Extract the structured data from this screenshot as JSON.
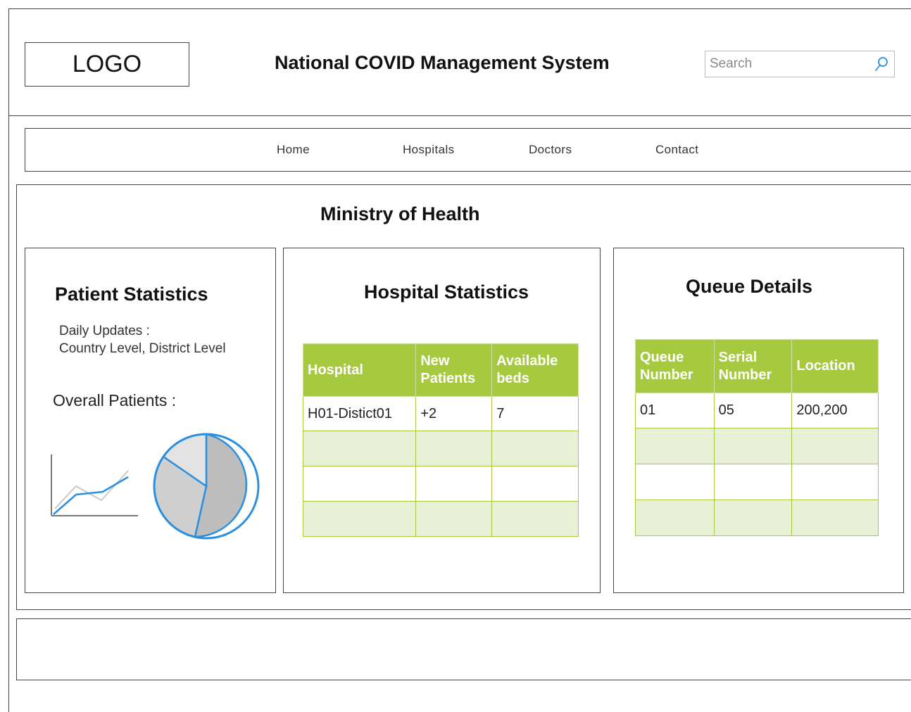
{
  "header": {
    "logo_text": "LOGO",
    "title": "National COVID Management System",
    "search_placeholder": "Search",
    "search_icon": "search-icon"
  },
  "nav": {
    "items": [
      {
        "label": "Home"
      },
      {
        "label": "Hospitals"
      },
      {
        "label": "Doctors"
      },
      {
        "label": "Contact"
      }
    ]
  },
  "main": {
    "title": "Ministry of Health",
    "patient_stats": {
      "title": "Patient Statistics",
      "daily_updates": "Daily Updates :",
      "levels": "Country Level, District Level",
      "overall_label": "Overall Patients :"
    },
    "hospital_stats": {
      "title": "Hospital Statistics",
      "columns": [
        "Hospital",
        "New Patients",
        "Available beds"
      ],
      "rows": [
        [
          "H01-Distict01",
          "+2",
          "7"
        ],
        [
          "",
          "",
          ""
        ],
        [
          "",
          "",
          ""
        ],
        [
          "",
          "",
          ""
        ]
      ]
    },
    "queue_details": {
      "title": "Queue Details",
      "columns": [
        "Queue Number",
        "Serial Number",
        "Location"
      ],
      "rows": [
        [
          "01",
          "05",
          "200,200"
        ],
        [
          "",
          "",
          ""
        ],
        [
          "",
          "",
          ""
        ],
        [
          "",
          "",
          ""
        ]
      ]
    }
  },
  "colors": {
    "table_header": "#a6c93f",
    "table_alt_row": "#e8f0d6",
    "chart_blue": "#2b8fe0"
  }
}
